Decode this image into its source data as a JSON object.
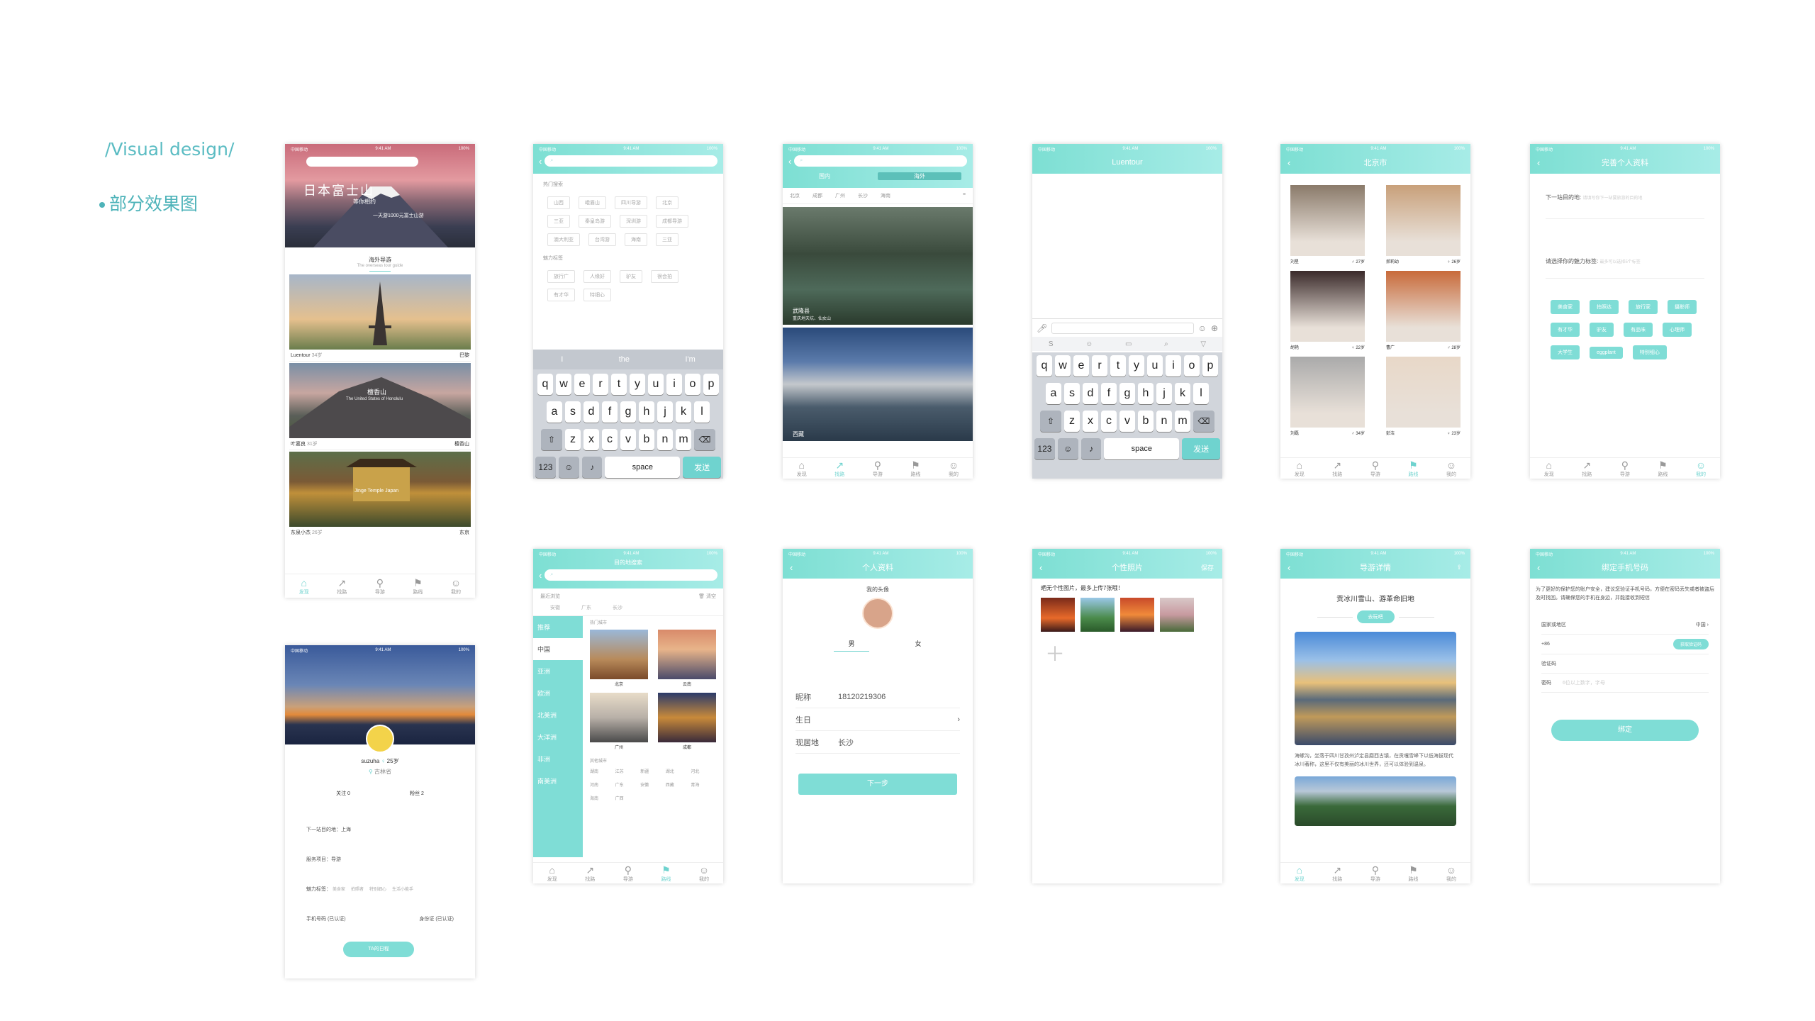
{
  "heading": {
    "title": "/Visual design/",
    "subtitle": "部分效果图"
  },
  "status": {
    "carrier": "中国移动",
    "time": "9:41 AM",
    "battery": "100%"
  },
  "tabs": [
    "发现",
    "找路",
    "导游",
    "路线",
    "我的"
  ],
  "s1": {
    "banner_title": "日本富士山",
    "banner_sub": "等你相约",
    "banner_price": "一天游1000元富士山游",
    "section_title": "海外导游",
    "section_sub": "The overseas tour guide",
    "cards": [
      {
        "name": "Luentour",
        "age": "34岁",
        "place": "巴黎",
        "caption": ""
      },
      {
        "name": "叶嘉良",
        "age": "31岁",
        "place": "檀香山",
        "caption": "檀香山",
        "caption_en": "The United States of Honolulu"
      },
      {
        "name": "东泉小杰",
        "age": "26岁",
        "place": "东京",
        "caption": "Jinge Temple Japan"
      }
    ]
  },
  "s2": {
    "hot_label": "热门搜索",
    "hot": [
      "山西",
      "峨眉山",
      "四川导游",
      "北京",
      "三亚",
      "秦皇岛游",
      "深圳游",
      "成都导游",
      "澳大利亚",
      "台湾游",
      "海南",
      "三亚"
    ],
    "charm_label": "魅力标签",
    "charm": [
      "旅行广",
      "人缘好",
      "驴友",
      "很会拍",
      "有才华",
      "特细心"
    ],
    "suggest": [
      "I",
      "the",
      "I'm"
    ],
    "rows": [
      [
        "q",
        "w",
        "e",
        "r",
        "t",
        "y",
        "u",
        "i",
        "o",
        "p"
      ],
      [
        "a",
        "s",
        "d",
        "f",
        "g",
        "h",
        "j",
        "k",
        "l"
      ],
      [
        "z",
        "x",
        "c",
        "v",
        "b",
        "n",
        "m"
      ]
    ],
    "num": "123",
    "space": "space",
    "send": "发送"
  },
  "s3": {
    "tab_domestic": "国内",
    "tab_overseas": "海外",
    "cities": [
      "北京",
      "成都",
      "广州",
      "长沙",
      "海南"
    ],
    "img1_title": "武隆县",
    "img1_sub": "重庆地天坑、仙女山",
    "img2_title": "西藏"
  },
  "s4": {
    "title": "Luentour"
  },
  "s5": {
    "title": "北京市",
    "people": [
      {
        "name": "刘星",
        "age": "♂ 27岁"
      },
      {
        "name": "郝莉幼",
        "age": "♀ 26岁"
      },
      {
        "name": "胡艳",
        "age": "♀ 22岁"
      },
      {
        "name": "曹广",
        "age": "♂ 28岁"
      },
      {
        "name": "刘磊",
        "age": "♂ 34岁"
      },
      {
        "name": "彭洁",
        "age": "♀ 23岁"
      }
    ]
  },
  "s6": {
    "title": "完善个人资料",
    "next_label": "下一站目的地:",
    "next_ph": "请填写你下一站要旅游的目的地",
    "tag_label": "请选择你的魅力标签:",
    "tag_ph": "最多可以选择5个标签",
    "tags": [
      "美食家",
      "拍照达",
      "旅行家",
      "摄影师",
      "有才华",
      "驴友",
      "有品味",
      "心理师",
      "大学生",
      "eggplant",
      "特别细心"
    ]
  },
  "s7": {
    "name": "suzuha",
    "age": "25岁",
    "place": "古林省",
    "follow": "关注 0",
    "fans": "粉丝 2",
    "next": "下一站目的地：上海",
    "service": "服务项目：导游",
    "charm": "魅力标签：",
    "charm_tags": [
      "美食家",
      "拍照者",
      "特别细心",
      "生活小能手"
    ],
    "phone": "手机号码 (已认证)",
    "id": "身份证 (已认证)",
    "btn": "TA的日程"
  },
  "s8": {
    "title": "目的地搜索",
    "recent_label": "最近浏览",
    "clear": "清空",
    "recent": [
      "安徽",
      "广东",
      "长沙"
    ],
    "side": [
      "推荐",
      "中国",
      "亚洲",
      "欧洲",
      "北美洲",
      "大洋洲",
      "非洲",
      "南美洲"
    ],
    "hot_label": "热门城市",
    "cities": [
      "北京",
      "云南",
      "广州",
      "成都"
    ],
    "other_label": "其他城市",
    "other": [
      "湖南",
      "江苏",
      "新疆",
      "湖北",
      "河北",
      "河南",
      "广东",
      "安徽",
      "西藏",
      "青海",
      "海南",
      "广西"
    ]
  },
  "s9": {
    "title": "个人资料",
    "avatar_label": "我的头像",
    "male": "男",
    "female": "女",
    "nick_label": "昵称",
    "nick": "18120219306",
    "birth_label": "生日",
    "home_label": "现居地",
    "home": "长沙",
    "btn": "下一步"
  },
  "s10": {
    "title": "个性照片",
    "right": "保存",
    "hint": "晒无个性图片，最多上传7张哦！"
  },
  "s11": {
    "title": "导游详情",
    "heading": "贡冰川雪山、游革命旧地",
    "tag": "去玩吧",
    "desc": "海螺沟，坐落于四川甘孜州泸定县磨西古镇，在贡嘎雪峰下以低海拔现代冰川著称，这里不仅有美丽的冰川世界，还可以体验到温泉。"
  },
  "s12": {
    "title": "绑定手机号码",
    "desc": "为了更好的保护您的账户安全，建议您验证手机号码，方便在密码丢失或者被盗后及时找回。请确保您的手机在身边，并能接收到短信",
    "region_label": "国家或地区",
    "region": "中国",
    "code": "+86",
    "get_code": "获取验证码",
    "verify_label": "验证码",
    "pwd_label": "密码",
    "pwd_ph": "6位以上数字，字母",
    "btn": "绑定"
  }
}
